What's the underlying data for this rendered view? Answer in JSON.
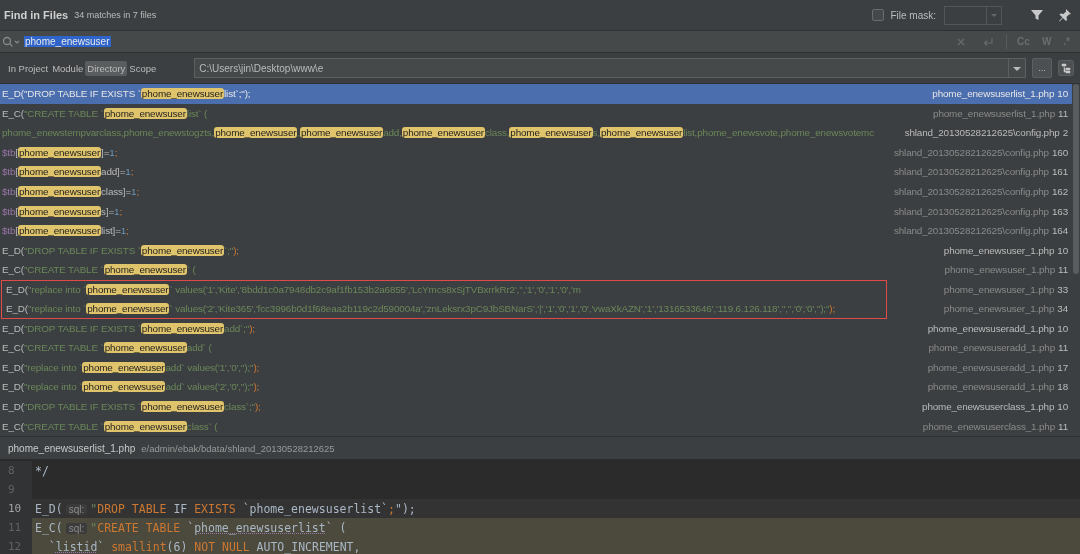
{
  "header": {
    "title": "Find in Files",
    "summary": "34 matches in 7 files",
    "file_mask": {
      "label": "File mask:",
      "checked": false
    }
  },
  "search": {
    "value": "phome_enewsuser",
    "options": [
      {
        "label": "Cc",
        "selected": false
      },
      {
        "label": "W",
        "selected": false
      },
      {
        "label": ".*",
        "selected": false
      }
    ]
  },
  "scopes": [
    {
      "label": "In Project",
      "selected": false
    },
    {
      "label": "Module",
      "selected": false
    },
    {
      "label": "Directory",
      "selected": true
    },
    {
      "label": "Scope",
      "selected": false
    }
  ],
  "directory": "C:\\Users\\jin\\Desktop\\www\\e",
  "browse_button": "...",
  "results": [
    {
      "selected": true,
      "boxed": false,
      "file": "phome_enewsuserlist_1.php",
      "line": "10",
      "dim": false,
      "parts": [
        {
          "kind": "plain",
          "text": "E_D("
        },
        {
          "kind": "str",
          "text": "\"DROP TABLE IF EXISTS `"
        },
        {
          "kind": "match",
          "text": "phome_enewsuser"
        },
        {
          "kind": "str",
          "text": "list`;\""
        },
        {
          "kind": "plain",
          "text": ");"
        }
      ]
    },
    {
      "selected": false,
      "boxed": false,
      "file": "phome_enewsuserlist_1.php",
      "line": "11",
      "dim": true,
      "parts": [
        {
          "kind": "plain",
          "text": "E_C("
        },
        {
          "kind": "str",
          "text": "\"CREATE TABLE `"
        },
        {
          "kind": "match",
          "text": "phome_enewsuser"
        },
        {
          "kind": "str",
          "text": "list` ("
        }
      ]
    },
    {
      "selected": false,
      "boxed": false,
      "file": "shland_20130528212625\\config.php",
      "line": "2",
      "dim": false,
      "parts": [
        {
          "kind": "str",
          "text": "phome_enewstempvarclass,phome_enewstogzts,"
        },
        {
          "kind": "match",
          "text": "phome_enewsuser"
        },
        {
          "kind": "str",
          "text": ","
        },
        {
          "kind": "match",
          "text": "phome_enewsuser"
        },
        {
          "kind": "str",
          "text": "add,"
        },
        {
          "kind": "match",
          "text": "phome_enewsuser"
        },
        {
          "kind": "str",
          "text": "class,"
        },
        {
          "kind": "match",
          "text": "phome_enewsuser"
        },
        {
          "kind": "str",
          "text": "s,"
        },
        {
          "kind": "match",
          "text": "phome_enewsuser"
        },
        {
          "kind": "str",
          "text": "list,phome_enewsvote,phome_enewsvotemc"
        }
      ]
    },
    {
      "selected": false,
      "boxed": false,
      "file": "shland_20130528212625\\config.php",
      "line": "160",
      "dim": true,
      "parts": [
        {
          "kind": "var",
          "text": "$tb"
        },
        {
          "kind": "plain",
          "text": "["
        },
        {
          "kind": "match",
          "text": "phome_enewsuser"
        },
        {
          "kind": "plain",
          "text": "]="
        },
        {
          "kind": "num",
          "text": "1"
        },
        {
          "kind": "punct",
          "text": ";"
        }
      ]
    },
    {
      "selected": false,
      "boxed": false,
      "file": "shland_20130528212625\\config.php",
      "line": "161",
      "dim": true,
      "parts": [
        {
          "kind": "var",
          "text": "$tb"
        },
        {
          "kind": "plain",
          "text": "["
        },
        {
          "kind": "match",
          "text": "phome_enewsuser"
        },
        {
          "kind": "plain",
          "text": "add]="
        },
        {
          "kind": "num",
          "text": "1"
        },
        {
          "kind": "punct",
          "text": ";"
        }
      ]
    },
    {
      "selected": false,
      "boxed": false,
      "file": "shland_20130528212625\\config.php",
      "line": "162",
      "dim": true,
      "parts": [
        {
          "kind": "var",
          "text": "$tb"
        },
        {
          "kind": "plain",
          "text": "["
        },
        {
          "kind": "match",
          "text": "phome_enewsuser"
        },
        {
          "kind": "plain",
          "text": "class]="
        },
        {
          "kind": "num",
          "text": "1"
        },
        {
          "kind": "punct",
          "text": ";"
        }
      ]
    },
    {
      "selected": false,
      "boxed": false,
      "file": "shland_20130528212625\\config.php",
      "line": "163",
      "dim": true,
      "parts": [
        {
          "kind": "var",
          "text": "$tb"
        },
        {
          "kind": "plain",
          "text": "["
        },
        {
          "kind": "match",
          "text": "phome_enewsuser"
        },
        {
          "kind": "plain",
          "text": "s]="
        },
        {
          "kind": "num",
          "text": "1"
        },
        {
          "kind": "punct",
          "text": ";"
        }
      ]
    },
    {
      "selected": false,
      "boxed": false,
      "file": "shland_20130528212625\\config.php",
      "line": "164",
      "dim": true,
      "parts": [
        {
          "kind": "var",
          "text": "$tb"
        },
        {
          "kind": "plain",
          "text": "["
        },
        {
          "kind": "match",
          "text": "phome_enewsuser"
        },
        {
          "kind": "plain",
          "text": "list]="
        },
        {
          "kind": "num",
          "text": "1"
        },
        {
          "kind": "punct",
          "text": ";"
        }
      ]
    },
    {
      "selected": false,
      "boxed": false,
      "file": "phome_enewsuser_1.php",
      "line": "10",
      "dim": false,
      "parts": [
        {
          "kind": "plain",
          "text": "E_D("
        },
        {
          "kind": "str",
          "text": "\"DROP TABLE IF EXISTS `"
        },
        {
          "kind": "match",
          "text": "phome_enewsuser"
        },
        {
          "kind": "str",
          "text": "`;\""
        },
        {
          "kind": "punct",
          "text": ");"
        }
      ]
    },
    {
      "selected": false,
      "boxed": false,
      "file": "phome_enewsuser_1.php",
      "line": "11",
      "dim": true,
      "parts": [
        {
          "kind": "plain",
          "text": "E_C("
        },
        {
          "kind": "str",
          "text": "\"CREATE TABLE `"
        },
        {
          "kind": "match",
          "text": "phome_enewsuser"
        },
        {
          "kind": "str",
          "text": "` ("
        }
      ]
    },
    {
      "selected": false,
      "boxed": true,
      "file": "phome_enewsuser_1.php",
      "line": "33",
      "dim": true,
      "parts": [
        {
          "kind": "plain",
          "text": "E_D("
        },
        {
          "kind": "str",
          "text": "\"replace into `"
        },
        {
          "kind": "match",
          "text": "phome_enewsuser"
        },
        {
          "kind": "str",
          "text": "` values('1','Kite','8bdd1c0a7948db2c9af1fb153b2a6855','LcYmcs8xSjTVBxrrkRr2','','1','0','1','0','m"
        }
      ]
    },
    {
      "selected": false,
      "boxed": true,
      "file": "phome_enewsuser_1.php",
      "line": "34",
      "dim": true,
      "parts": [
        {
          "kind": "plain",
          "text": "E_D("
        },
        {
          "kind": "str",
          "text": "\"replace into `"
        },
        {
          "kind": "match",
          "text": "phome_enewsuser"
        },
        {
          "kind": "str",
          "text": "` values('2','Kite365','fcc3996b0d1f68eaa2b119c2d590004a','znLeksrx3pC9JbSBNarS','|','1','0','1','0','vwaXkAZN','1','1316533646','119.6.126.118','','','0','0','');\""
        },
        {
          "kind": "punct",
          "text": ");"
        }
      ]
    },
    {
      "selected": false,
      "boxed": false,
      "file": "phome_enewsuseradd_1.php",
      "line": "10",
      "dim": false,
      "parts": [
        {
          "kind": "plain",
          "text": "E_D("
        },
        {
          "kind": "str",
          "text": "\"DROP TABLE IF EXISTS `"
        },
        {
          "kind": "match",
          "text": "phome_enewsuser"
        },
        {
          "kind": "str",
          "text": "add`;\""
        },
        {
          "kind": "punct",
          "text": ");"
        }
      ]
    },
    {
      "selected": false,
      "boxed": false,
      "file": "phome_enewsuseradd_1.php",
      "line": "11",
      "dim": true,
      "parts": [
        {
          "kind": "plain",
          "text": "E_C("
        },
        {
          "kind": "str",
          "text": "\"CREATE TABLE `"
        },
        {
          "kind": "match",
          "text": "phome_enewsuser"
        },
        {
          "kind": "str",
          "text": "add` ("
        }
      ]
    },
    {
      "selected": false,
      "boxed": false,
      "file": "phome_enewsuseradd_1.php",
      "line": "17",
      "dim": true,
      "parts": [
        {
          "kind": "plain",
          "text": "E_D("
        },
        {
          "kind": "str",
          "text": "\"replace into `"
        },
        {
          "kind": "match",
          "text": "phome_enewsuser"
        },
        {
          "kind": "str",
          "text": "add` values('1','0','');\""
        },
        {
          "kind": "punct",
          "text": ");"
        }
      ]
    },
    {
      "selected": false,
      "boxed": false,
      "file": "phome_enewsuseradd_1.php",
      "line": "18",
      "dim": true,
      "parts": [
        {
          "kind": "plain",
          "text": "E_D("
        },
        {
          "kind": "str",
          "text": "\"replace into `"
        },
        {
          "kind": "match",
          "text": "phome_enewsuser"
        },
        {
          "kind": "str",
          "text": "add` values('2','0','');\""
        },
        {
          "kind": "punct",
          "text": ");"
        }
      ]
    },
    {
      "selected": false,
      "boxed": false,
      "file": "phome_enewsuserclass_1.php",
      "line": "10",
      "dim": false,
      "parts": [
        {
          "kind": "plain",
          "text": "E_D("
        },
        {
          "kind": "str",
          "text": "\"DROP TABLE IF EXISTS `"
        },
        {
          "kind": "match",
          "text": "phome_enewsuser"
        },
        {
          "kind": "str",
          "text": "class`;\""
        },
        {
          "kind": "punct",
          "text": ");"
        }
      ]
    },
    {
      "selected": false,
      "boxed": false,
      "file": "phome_enewsuserclass_1.php",
      "line": "11",
      "dim": true,
      "parts": [
        {
          "kind": "plain",
          "text": "E_C("
        },
        {
          "kind": "str",
          "text": "\"CREATE TABLE `"
        },
        {
          "kind": "match",
          "text": "phome_enewsuser"
        },
        {
          "kind": "str",
          "text": "class` ("
        }
      ]
    }
  ],
  "preview": {
    "file": "phome_enewsuserlist_1.php",
    "path": "e/admin/ebak/bdata/shland_20130528212625",
    "lines": [
      {
        "number": "8",
        "current": false,
        "injected": false,
        "parts": [
          {
            "kind": "plain",
            "text": "*/"
          }
        ]
      },
      {
        "number": "9",
        "current": false,
        "injected": false
      },
      {
        "number": "10",
        "current": true,
        "injected": true,
        "parts": [
          {
            "kind": "plain",
            "text": "E_D("
          },
          {
            "kind": "hint",
            "text": "sql:"
          },
          {
            "kind": "str",
            "text": "\""
          },
          {
            "kind": "kw",
            "text": "DROP TABLE"
          },
          {
            "kind": "plain",
            "text": " IF "
          },
          {
            "kind": "kw",
            "text": "EXISTS"
          },
          {
            "kind": "plain",
            "text": " `phome_enewsuserlist`"
          },
          {
            "kind": "kw",
            "text": ";"
          },
          {
            "kind": "plain",
            "text": "\");"
          }
        ]
      },
      {
        "number": "11",
        "current": false,
        "injected": true,
        "parts": [
          {
            "kind": "plain",
            "text": "E_C("
          },
          {
            "kind": "hint",
            "text": "sql:"
          },
          {
            "kind": "str",
            "text": "\""
          },
          {
            "kind": "kw",
            "text": "CREATE TABLE"
          },
          {
            "kind": "plain",
            "text": " `"
          },
          {
            "kind": "ident",
            "text": "phome_enewsuserlist"
          },
          {
            "kind": "plain",
            "text": "` ("
          }
        ]
      },
      {
        "number": "12",
        "current": false,
        "injected": true,
        "parts": [
          {
            "kind": "plain",
            "text": "  `"
          },
          {
            "kind": "ident",
            "text": "listid"
          },
          {
            "kind": "plain",
            "text": "` "
          },
          {
            "kind": "kw",
            "text": "smallint"
          },
          {
            "kind": "plain",
            "text": "(6) "
          },
          {
            "kind": "kw",
            "text": "NOT NULL"
          },
          {
            "kind": "plain",
            "text": " AUTO_INCREMENT,"
          }
        ]
      }
    ]
  }
}
